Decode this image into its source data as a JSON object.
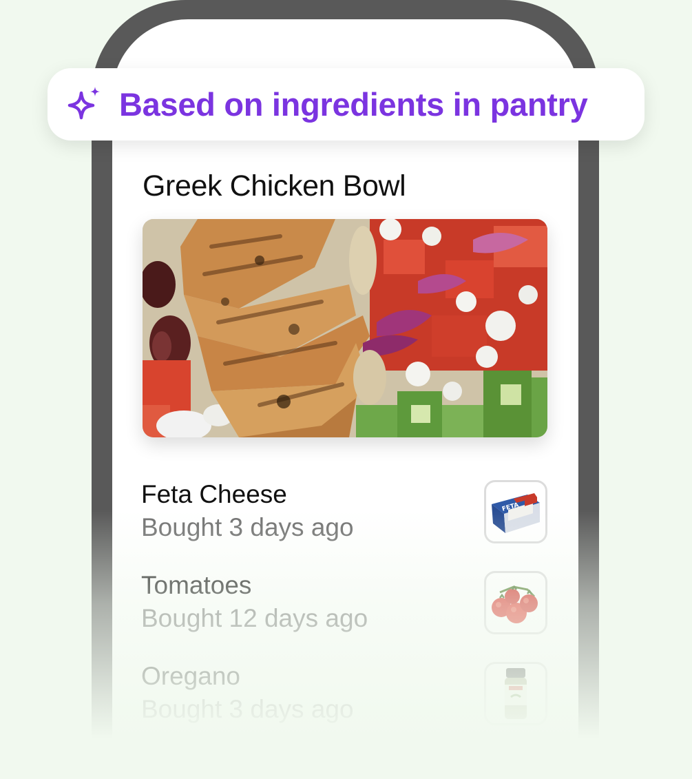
{
  "badge": {
    "icon": "sparkle-icon",
    "text": "Based on ingredients in pantry",
    "color": "#7b34e0"
  },
  "recipe": {
    "title": "Greek Chicken Bowl",
    "image": "greek-chicken-bowl-photo"
  },
  "ingredients": [
    {
      "name": "Feta Cheese",
      "subtitle": "Bought 3 days ago",
      "thumbnail": "feta-package-icon"
    },
    {
      "name": "Tomatoes",
      "subtitle": "Bought 12 days ago",
      "thumbnail": "tomato-vine-icon"
    },
    {
      "name": "Oregano",
      "subtitle": "Bought 3 days ago",
      "thumbnail": "oregano-jar-icon"
    }
  ],
  "colors": {
    "background": "#f1f9ef",
    "phone_frame": "#595959",
    "accent": "#7b34e0"
  }
}
